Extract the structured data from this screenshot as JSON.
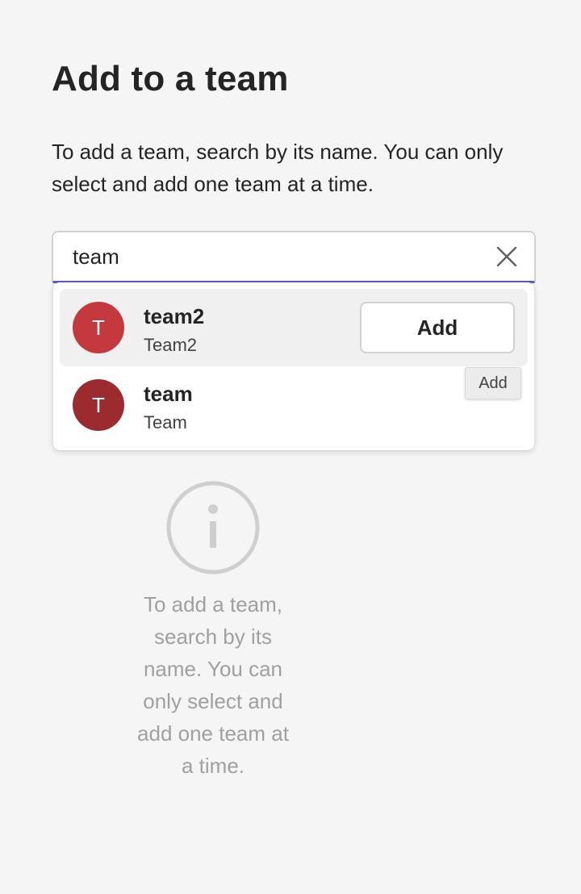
{
  "page": {
    "title": "Add to a team",
    "description": "To add a team, search by its name. You can only select and add one team at a time."
  },
  "search": {
    "value": "team",
    "clear_icon": "close-icon",
    "accent_color": "#5b5fc7"
  },
  "results": [
    {
      "initial": "T",
      "name": "team2",
      "subtitle": "Team2",
      "avatar_color": "#c4393d",
      "hovered": true,
      "action_label": "Add"
    },
    {
      "initial": "T",
      "name": "team",
      "subtitle": "Team",
      "avatar_color": "#9c2b2f",
      "hovered": false
    }
  ],
  "tooltip": {
    "text": "Add"
  },
  "empty_state": {
    "icon": "info-icon",
    "text": "To add a team, search by its name. You can only select and add one team at a time."
  }
}
